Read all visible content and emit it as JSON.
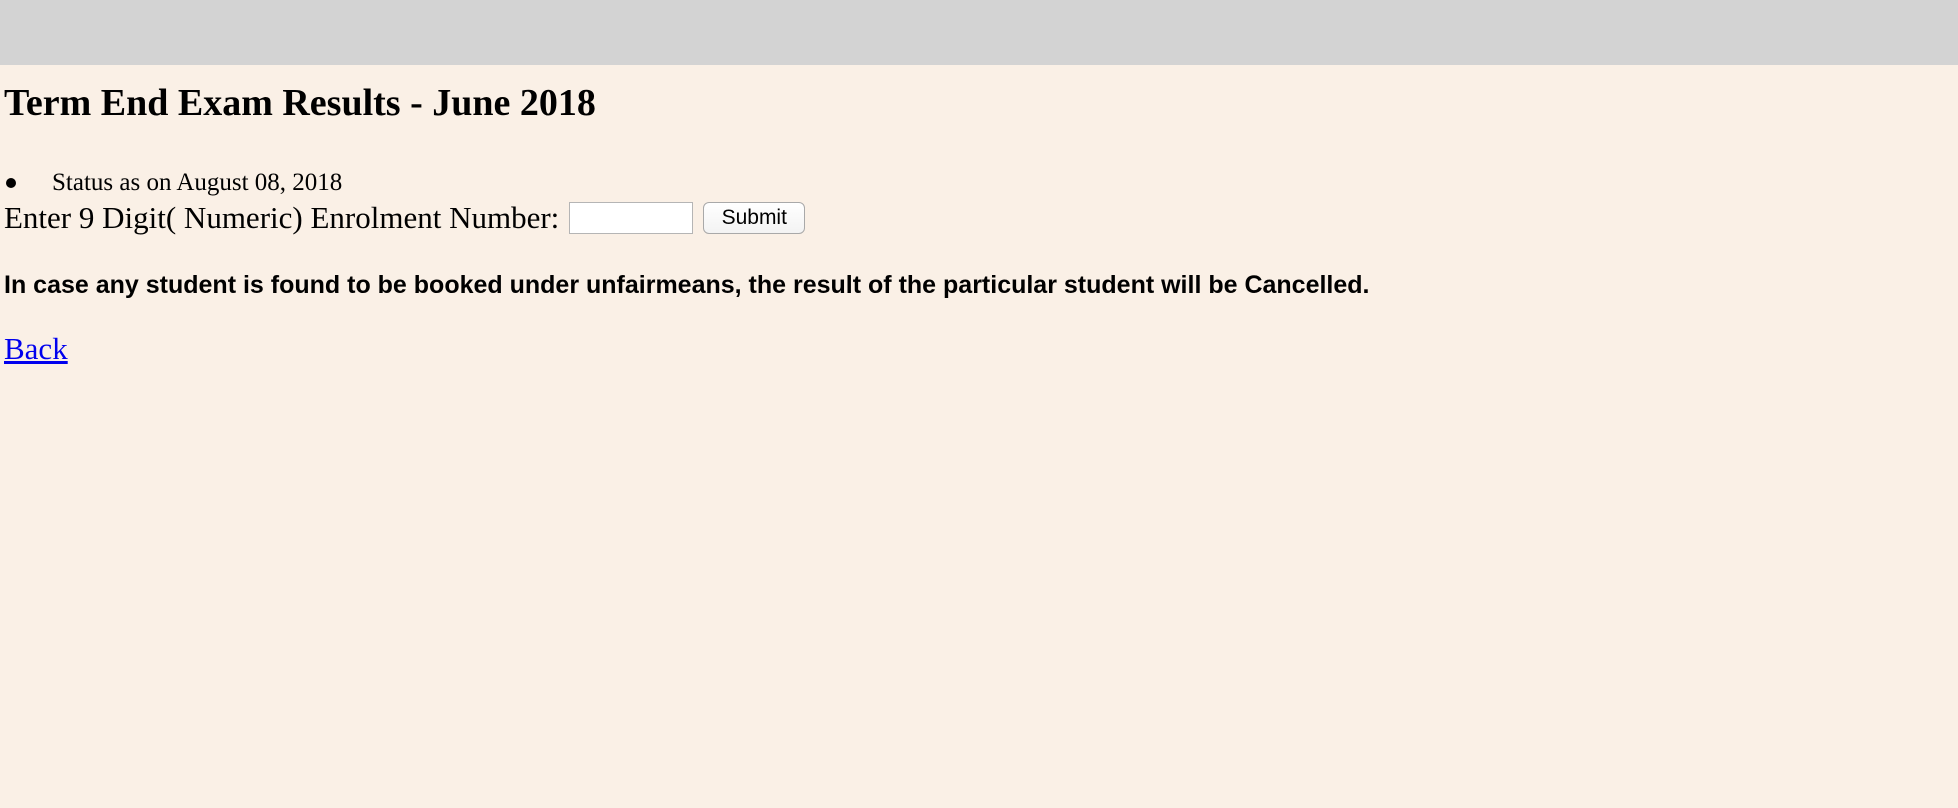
{
  "colors": {
    "background": "#FAF0E6",
    "header_bar": "#D3D3D3",
    "link": "#0000EE"
  },
  "page": {
    "title": "Term End Exam Results - June 2018",
    "status_text": "Status as on August 08, 2018"
  },
  "form": {
    "enrolment_label": "Enter 9 Digit( Numeric) Enrolment Number:",
    "enrolment_value": "",
    "submit_label": "Submit"
  },
  "notice": {
    "text": "In case any student is found to be booked under unfairmeans, the result of the particular student will be Cancelled."
  },
  "nav": {
    "back_label": "Back"
  }
}
